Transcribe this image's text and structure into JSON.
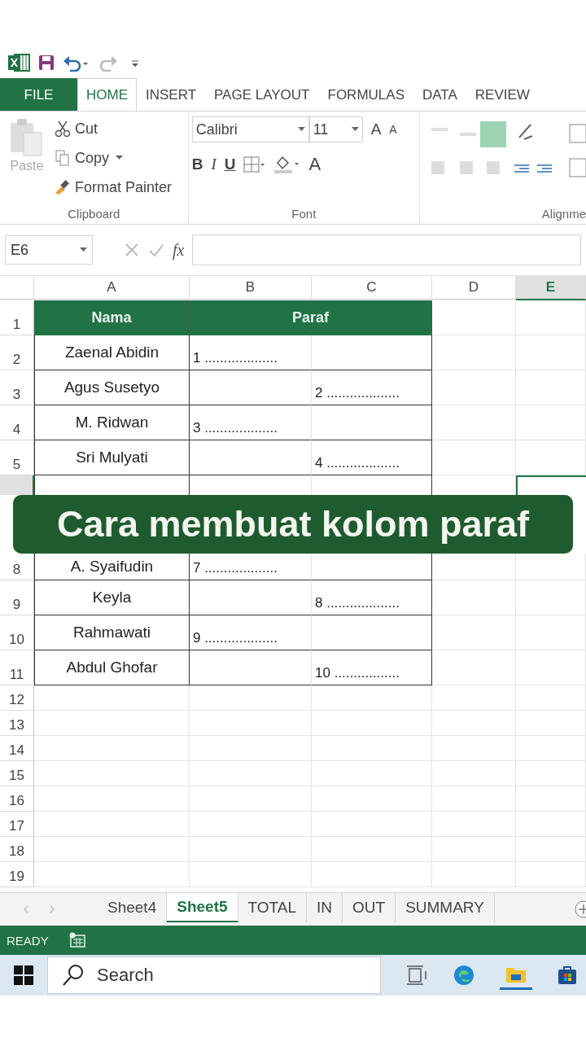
{
  "ribbon_tabs": [
    {
      "label": "FILE",
      "kind": "file",
      "selected": false
    },
    {
      "label": "HOME",
      "kind": "tab",
      "selected": true
    },
    {
      "label": "INSERT",
      "kind": "tab",
      "selected": false
    },
    {
      "label": "PAGE LAYOUT",
      "kind": "tab",
      "selected": false
    },
    {
      "label": "FORMULAS",
      "kind": "tab",
      "selected": false
    },
    {
      "label": "DATA",
      "kind": "tab",
      "selected": false
    },
    {
      "label": "REVIEW",
      "kind": "tab",
      "selected": false
    }
  ],
  "clipboard": {
    "paste": "Paste",
    "cut": "Cut",
    "copy": "Copy",
    "format_painter": "Format Painter",
    "label": "Clipboard"
  },
  "font": {
    "family": "Calibri",
    "size": "11",
    "grow": "A",
    "shrink": "A",
    "bold": "B",
    "italic": "I",
    "underline": "U",
    "font_color_button": "A",
    "label": "Font"
  },
  "alignment": {
    "label": "Alignme"
  },
  "name_box": "E6",
  "formula_fx": "fx",
  "columns": [
    {
      "label": "A",
      "selected": false
    },
    {
      "label": "B",
      "selected": false
    },
    {
      "label": "C",
      "selected": false
    },
    {
      "label": "D",
      "selected": false
    },
    {
      "label": "E",
      "selected": true
    }
  ],
  "rows": [
    {
      "kind": "header",
      "number": "1",
      "selected": false,
      "name": "Nama",
      "sign": "Paraf"
    },
    {
      "kind": "entry",
      "number": "2",
      "selected": false,
      "name": "Zaenal Abidin",
      "b": "1 ...................",
      "c": ""
    },
    {
      "kind": "entry",
      "number": "3",
      "selected": false,
      "name": "Agus Susetyo",
      "b": "",
      "c": "2 ..................."
    },
    {
      "kind": "entry",
      "number": "4",
      "selected": false,
      "name": "M. Ridwan",
      "b": "3 ...................",
      "c": ""
    },
    {
      "kind": "entry",
      "number": "5",
      "selected": false,
      "name": "Sri Mulyati",
      "b": "",
      "c": "4 ..................."
    },
    {
      "kind": "covered",
      "selected": true
    },
    {
      "kind": "entry",
      "number": "8",
      "selected": false,
      "name": "A. Syaifudin",
      "b": "7 ...................",
      "c": ""
    },
    {
      "kind": "entry",
      "number": "9",
      "selected": false,
      "name": "Keyla",
      "b": "",
      "c": "8 ..................."
    },
    {
      "kind": "entry",
      "number": "10",
      "selected": false,
      "name": "Rahmawati",
      "b": "9 ...................",
      "c": ""
    },
    {
      "kind": "entry",
      "number": "11",
      "selected": false,
      "name": "Abdul Ghofar",
      "b": "",
      "c": "10 ................."
    },
    {
      "kind": "empty",
      "number": "12",
      "selected": false
    },
    {
      "kind": "empty",
      "number": "13",
      "selected": false
    },
    {
      "kind": "empty",
      "number": "14",
      "selected": false
    },
    {
      "kind": "empty",
      "number": "15",
      "selected": false
    },
    {
      "kind": "empty",
      "number": "16",
      "selected": false
    },
    {
      "kind": "empty",
      "number": "17",
      "selected": false
    },
    {
      "kind": "empty",
      "number": "18",
      "selected": false
    },
    {
      "kind": "empty",
      "number": "19",
      "selected": false
    }
  ],
  "caption": "Cara membuat kolom paraf",
  "sheet_tabs": [
    {
      "label": "Sheet4",
      "selected": false
    },
    {
      "label": "Sheet5",
      "selected": true
    },
    {
      "label": "TOTAL",
      "selected": false
    },
    {
      "label": "IN",
      "selected": false
    },
    {
      "label": "OUT",
      "selected": false
    },
    {
      "label": "SUMMARY",
      "selected": false
    }
  ],
  "status": "READY",
  "taskbar": {
    "search_placeholder": "Search"
  }
}
